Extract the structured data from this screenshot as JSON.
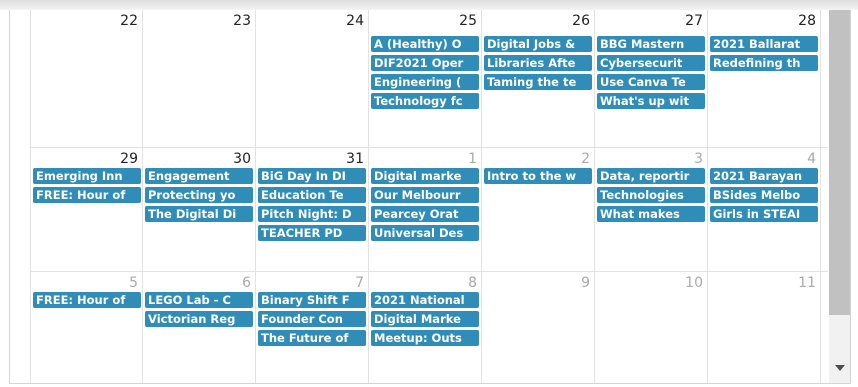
{
  "weeks": [
    {
      "days": [
        {
          "num": "22",
          "other": false,
          "events": []
        },
        {
          "num": "23",
          "other": false,
          "events": []
        },
        {
          "num": "24",
          "other": false,
          "events": []
        },
        {
          "num": "25",
          "other": false,
          "events": [
            "A (Healthy) O",
            "DIF2021 Oper",
            "Engineering (",
            "Technology fc"
          ]
        },
        {
          "num": "26",
          "other": false,
          "events": [
            "Digital Jobs &",
            "Libraries Afte",
            "Taming the te"
          ]
        },
        {
          "num": "27",
          "other": false,
          "events": [
            "BBG Mastern",
            "Cybersecurit",
            "Use Canva Te",
            "What's up wit"
          ]
        },
        {
          "num": "28",
          "other": false,
          "events": [
            "2021 Ballarat",
            "Redefining th"
          ]
        }
      ]
    },
    {
      "days": [
        {
          "num": "29",
          "other": false,
          "events": [
            "Emerging Inn",
            "FREE: Hour of"
          ]
        },
        {
          "num": "30",
          "other": false,
          "events": [
            "Engagement",
            "Protecting yo",
            "The Digital Di"
          ]
        },
        {
          "num": "31",
          "other": false,
          "events": [
            "BiG Day In DI",
            "Education Te",
            "Pitch Night: D",
            "TEACHER PD"
          ]
        },
        {
          "num": "1",
          "other": true,
          "events": [
            "Digital marke",
            "Our Melbourr",
            "Pearcey Orat",
            "Universal Des"
          ]
        },
        {
          "num": "2",
          "other": true,
          "events": [
            "Intro to the w"
          ]
        },
        {
          "num": "3",
          "other": true,
          "events": [
            "Data, reportir",
            "Technologies",
            "What makes"
          ]
        },
        {
          "num": "4",
          "other": true,
          "events": [
            "2021 Barayan",
            "BSides Melbo",
            "Girls in STEAI"
          ]
        }
      ]
    },
    {
      "days": [
        {
          "num": "5",
          "other": true,
          "events": [
            "FREE: Hour of"
          ]
        },
        {
          "num": "6",
          "other": true,
          "events": [
            "LEGO Lab - C",
            "Victorian Reg"
          ]
        },
        {
          "num": "7",
          "other": true,
          "events": [
            "Binary Shift F",
            "Founder Con",
            "The Future of"
          ]
        },
        {
          "num": "8",
          "other": true,
          "events": [
            "2021 National",
            "Digital Marke",
            "Meetup: Outs"
          ]
        },
        {
          "num": "9",
          "other": true,
          "events": []
        },
        {
          "num": "10",
          "other": true,
          "events": []
        },
        {
          "num": "11",
          "other": true,
          "events": []
        }
      ]
    }
  ],
  "colors": {
    "event_bg": "#2f8db8",
    "event_text": "#ffffff"
  },
  "icons": {
    "scroll_down": "caret-down-icon"
  }
}
